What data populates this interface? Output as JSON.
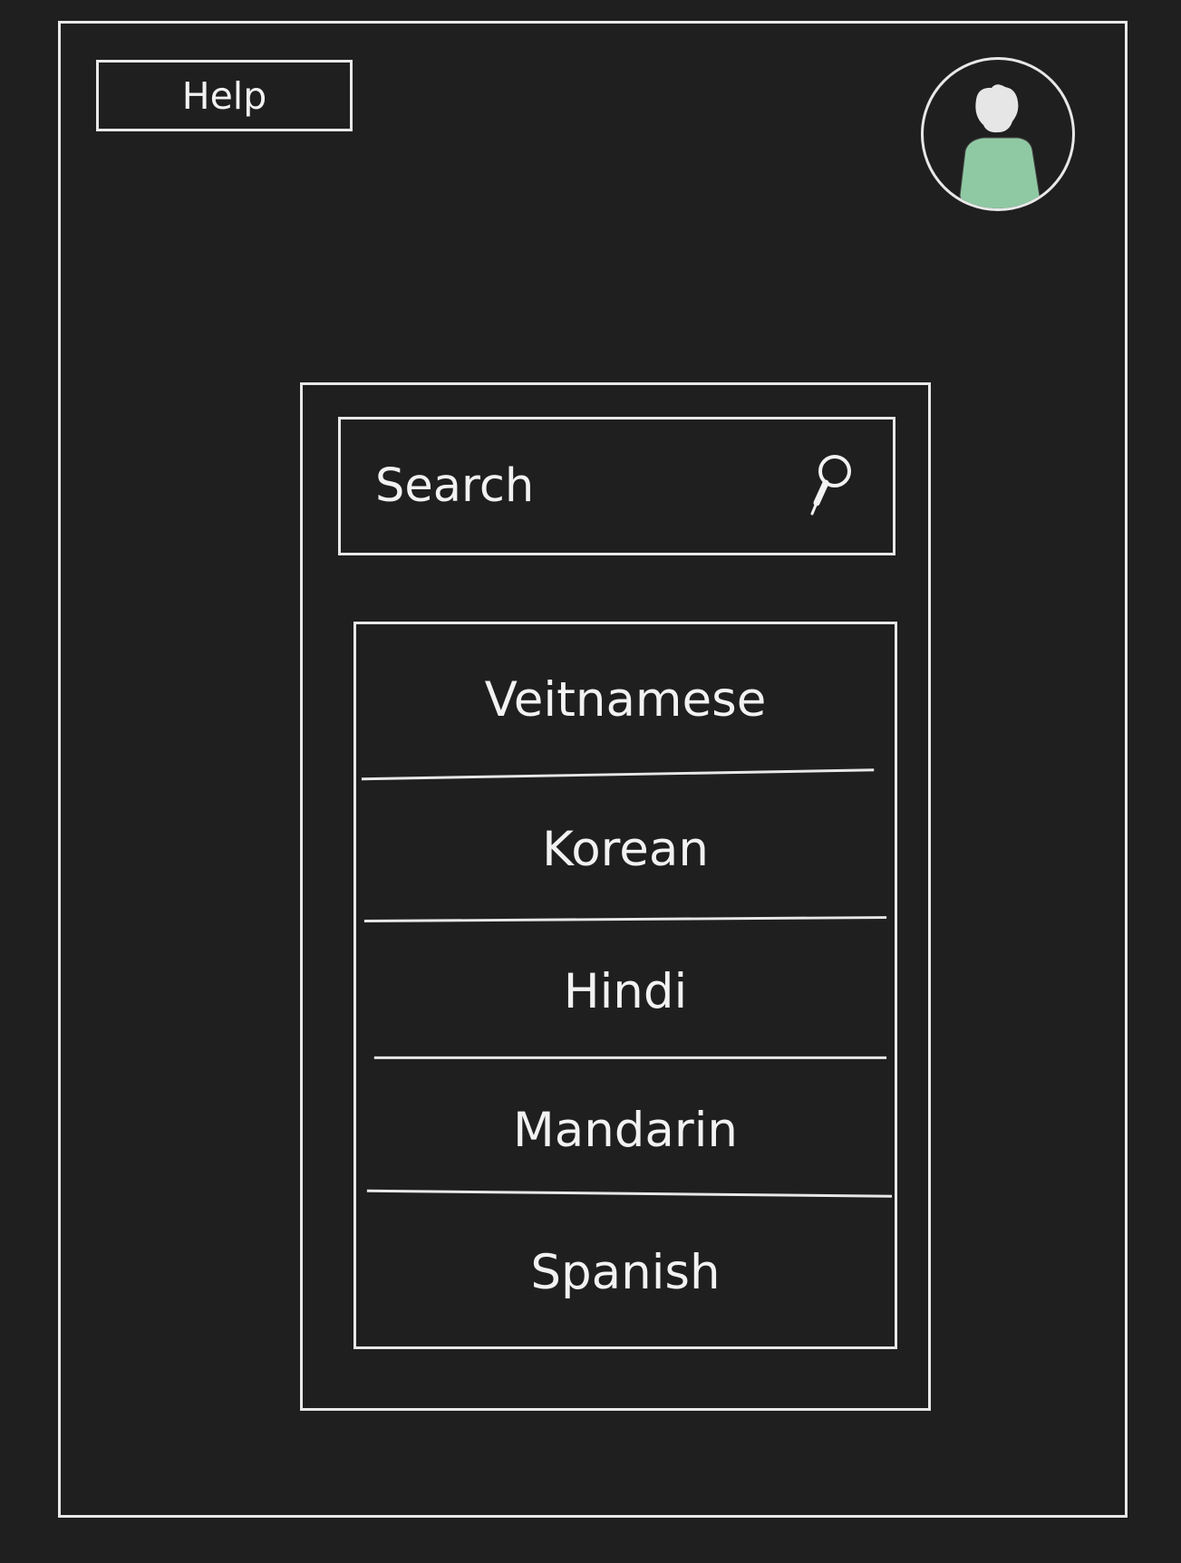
{
  "header": {
    "help_label": "Help",
    "avatar_icon": "user-avatar-icon"
  },
  "search": {
    "placeholder": "Search",
    "icon": "search-icon"
  },
  "languages": [
    {
      "label": "Veitnamese"
    },
    {
      "label": "Korean"
    },
    {
      "label": "Hindi"
    },
    {
      "label": "Mandarin"
    },
    {
      "label": "Spanish"
    }
  ],
  "colors": {
    "background": "#1f1f1f",
    "stroke": "#e8e8e8",
    "text": "#f2f2f2",
    "avatar_body": "#8fc9a3",
    "avatar_head": "#e6e6e6"
  }
}
